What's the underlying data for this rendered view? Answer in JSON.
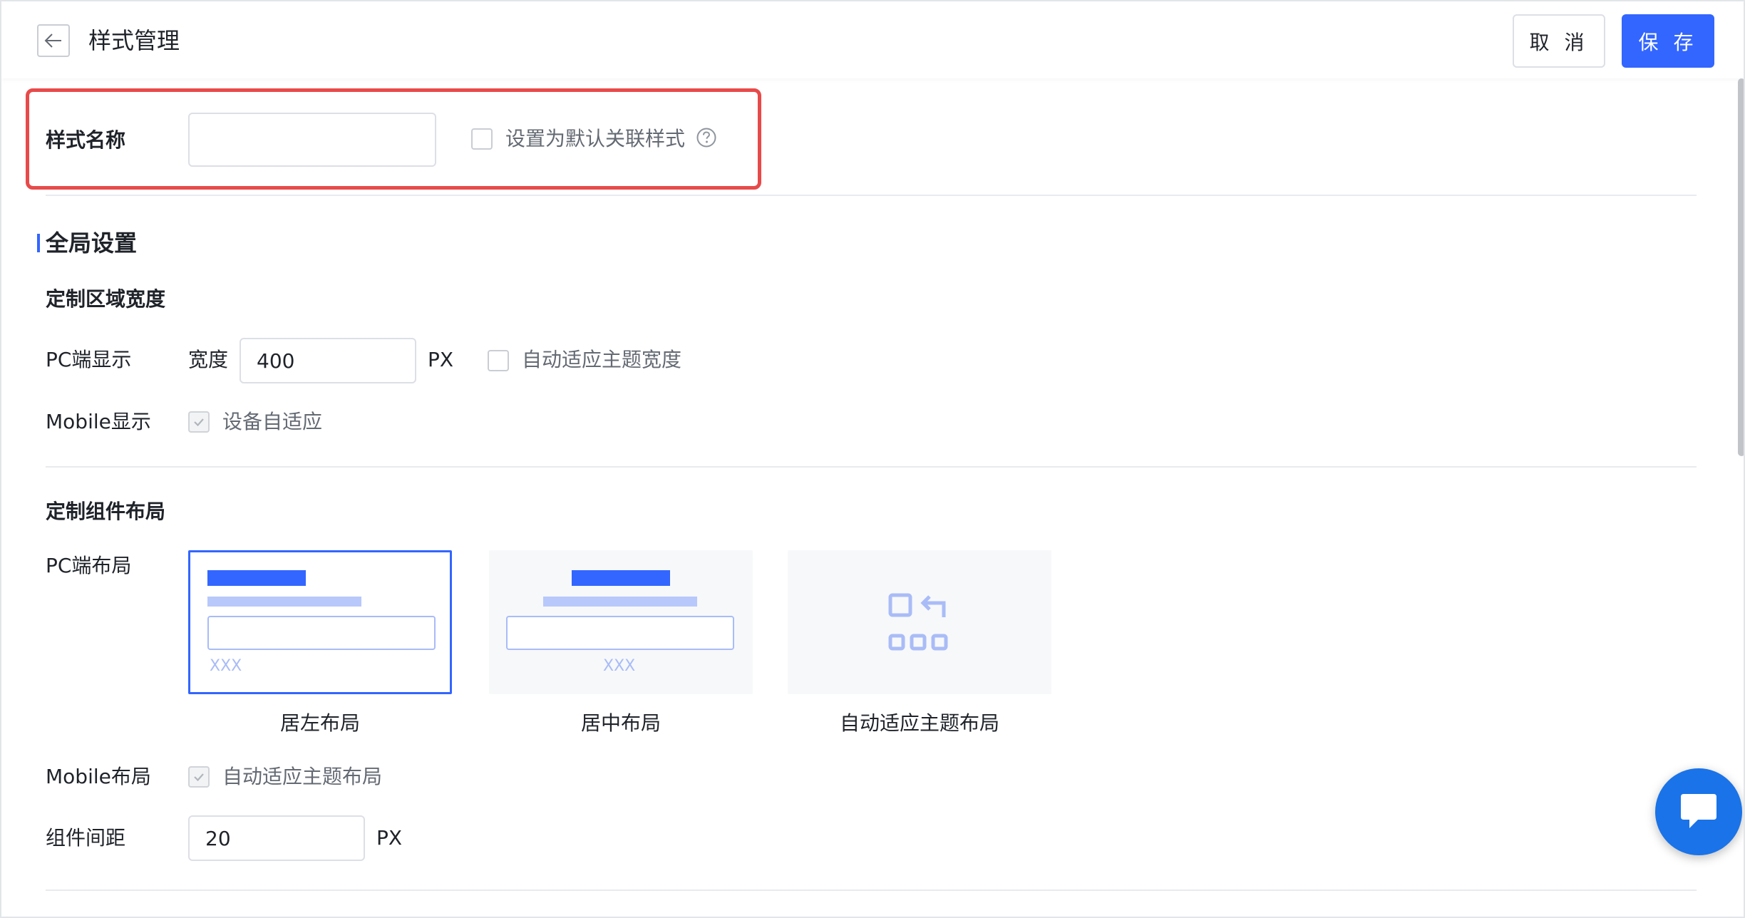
{
  "header": {
    "title": "样式管理",
    "cancel_label": "取 消",
    "save_label": "保 存"
  },
  "name_row": {
    "label": "样式名称",
    "input_value": "",
    "default_checkbox_label": "设置为默认关联样式",
    "default_checked": false
  },
  "global": {
    "title": "全局设置",
    "width_section": {
      "title": "定制区域宽度",
      "pc_label": "PC端显示",
      "width_label": "宽度",
      "width_value": "400",
      "unit": "PX",
      "auto_width_label": "自动适应主题宽度",
      "auto_width_checked": false,
      "mobile_label": "Mobile显示",
      "mobile_option_label": "设备自适应",
      "mobile_checked": true
    },
    "layout_section": {
      "title": "定制组件布局",
      "pc_label": "PC端布局",
      "options": [
        {
          "label": "居左布局",
          "placeholder": "XXX",
          "selected": true
        },
        {
          "label": "居中布局",
          "placeholder": "XXX",
          "selected": false
        },
        {
          "label": "自动适应主题布局",
          "selected": false
        }
      ],
      "mobile_label": "Mobile布局",
      "mobile_option_label": "自动适应主题布局",
      "mobile_checked": true,
      "spacing_label": "组件间距",
      "spacing_value": "20",
      "spacing_unit": "PX"
    }
  },
  "colors": {
    "accent": "#3366ff",
    "highlight": "#e84a4a",
    "chat": "#1a73e8"
  },
  "icons": {
    "back": "arrow-left-icon",
    "help": "question-circle-icon",
    "check": "check-icon",
    "auto_layout": "auto-layout-icon",
    "chat": "chat-bubble-icon"
  }
}
